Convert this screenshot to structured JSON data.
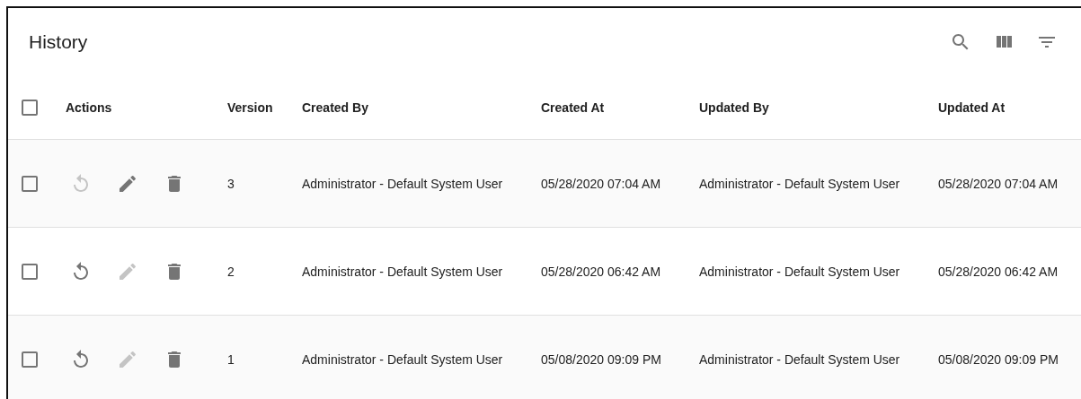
{
  "title": "History",
  "header": {
    "checked": false,
    "columns": [
      "Actions",
      "Version",
      "Created By",
      "Created At",
      "Updated By",
      "Updated At"
    ]
  },
  "rows": [
    {
      "checked": false,
      "restore_disabled": true,
      "edit_disabled": false,
      "delete_disabled": false,
      "cells": [
        "3",
        "Administrator - Default System User",
        "05/28/2020 07:04 AM",
        "Administrator - Default System User",
        "05/28/2020 07:04 AM"
      ]
    },
    {
      "checked": false,
      "restore_disabled": false,
      "edit_disabled": true,
      "delete_disabled": false,
      "cells": [
        "2",
        "Administrator - Default System User",
        "05/28/2020 06:42 AM",
        "Administrator - Default System User",
        "05/28/2020 06:42 AM"
      ]
    },
    {
      "checked": false,
      "restore_disabled": false,
      "edit_disabled": true,
      "delete_disabled": false,
      "cells": [
        "1",
        "Administrator - Default System User",
        "05/08/2020 09:09 PM",
        "Administrator - Default System User",
        "05/08/2020 09:09 PM"
      ]
    }
  ]
}
